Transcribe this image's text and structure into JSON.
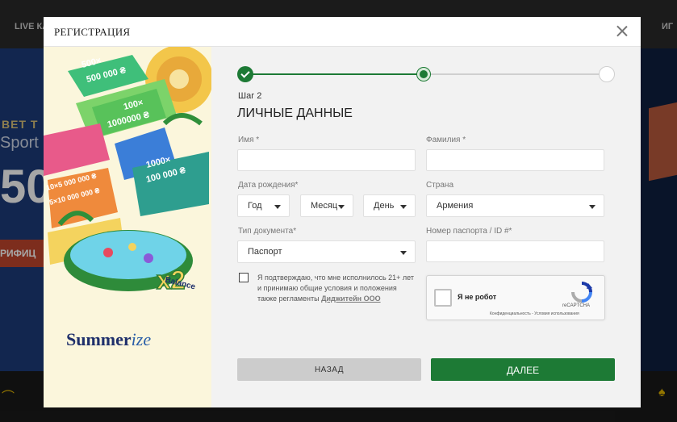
{
  "background": {
    "nav_left": "LIVE КА",
    "nav_right": "ИГ",
    "banner_line1": "ВЕТ Т",
    "banner_line2": "Sport",
    "banner_big": "50",
    "banner_cta": "РИФИЦ"
  },
  "modal": {
    "title": "РЕГИСТРАЦИЯ",
    "promo": {
      "brand_main": "Summer",
      "brand_italic": "ize",
      "balance_label": "Balance"
    },
    "stepper": {
      "current_step": 2,
      "total_steps": 3,
      "step_label": "Шаг 2",
      "step_title": "ЛИЧНЫЕ ДАННЫЕ"
    },
    "form": {
      "first_name_label": "Имя *",
      "first_name_value": "",
      "last_name_label": "Фамилия *",
      "last_name_value": "",
      "birth_date_label": "Дата рождения*",
      "birth_year": "Год",
      "birth_month": "Месяц",
      "birth_day": "День",
      "country_label": "Страна",
      "country_value": "Армения",
      "doc_type_label": "Тип документа*",
      "doc_type_value": "Паспорт",
      "passport_label": "Номер паспорта / ID #*",
      "passport_value": "",
      "consent_text": "Я подтверждаю, что мне исполнилось 21+ лет и принимаю общие условия и положения также регламенты ",
      "consent_link": "Диджитейн ООО"
    },
    "recaptcha": {
      "label": "Я не робот",
      "brand": "reCAPTCHA",
      "terms": "Конфиденциальность - Условия использования"
    },
    "buttons": {
      "back": "НАЗАД",
      "next": "ДАЛЕЕ"
    }
  }
}
